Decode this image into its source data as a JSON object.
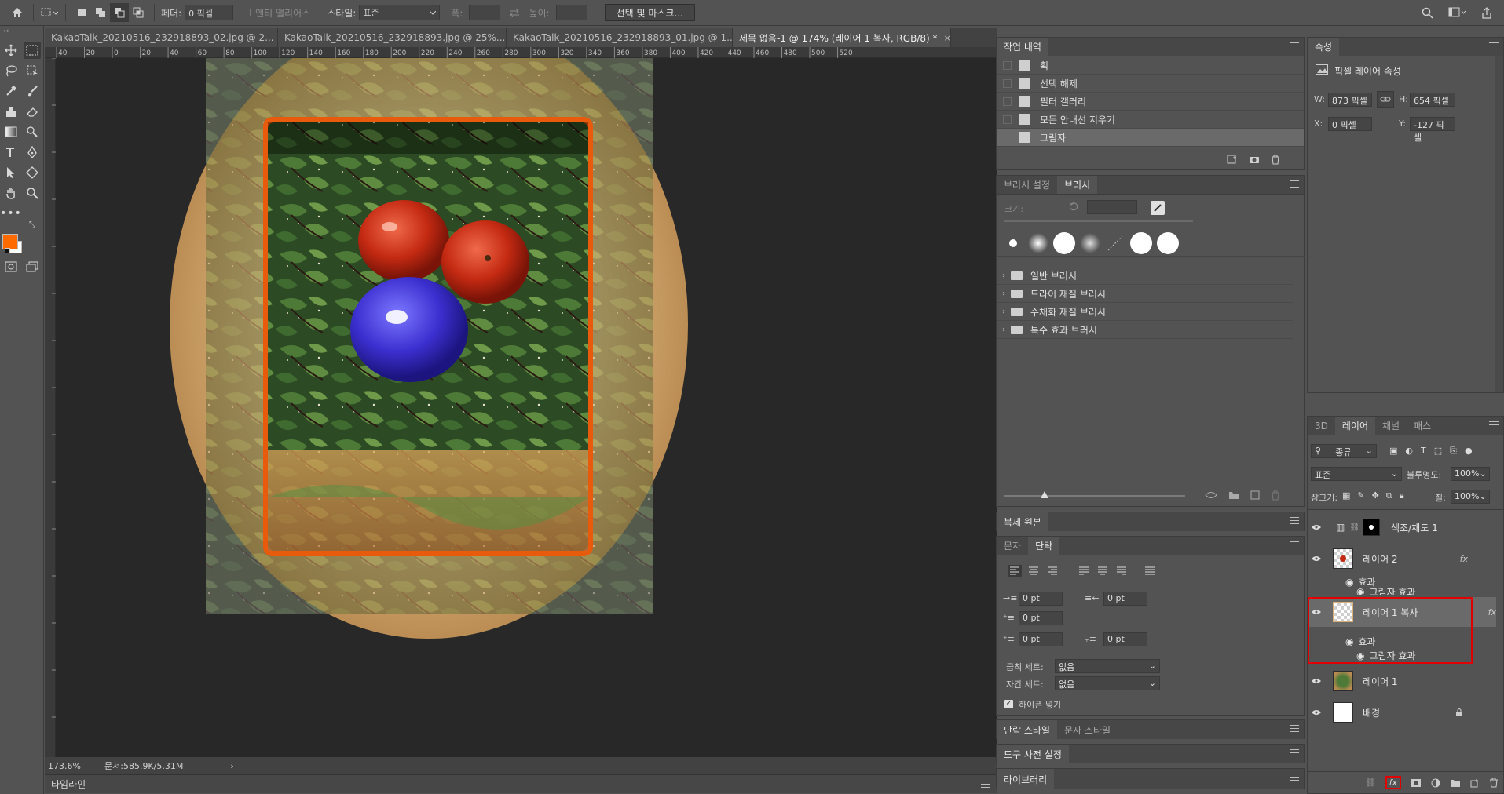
{
  "options_bar": {
    "feather_label": "페더:",
    "feather_value": "0 픽셀",
    "antialias_label": "앤티 앨리어스",
    "style_label": "스타일:",
    "style_value": "표준",
    "width_label": "폭:",
    "height_label": "높이:",
    "select_mask_button": "선택 및 마스크..."
  },
  "colors": {
    "foreground": "#ff6a00",
    "background": "#ffffff",
    "accent_highlight": "#e00000"
  },
  "tabs": [
    {
      "label": "KakaoTalk_20210516_232918893_02.jpg @ 2...",
      "close": "×"
    },
    {
      "label": "KakaoTalk_20210516_232918893.jpg @ 25%...",
      "close": "×"
    },
    {
      "label": "KakaoTalk_20210516_232918893_01.jpg @ 1...",
      "close": "×"
    },
    {
      "label": "제목 없음-1 @ 174% (레이어 1 복사, RGB/8) *",
      "close": "×"
    }
  ],
  "ruler": {
    "top_ticks": [
      "40",
      "20",
      "0",
      "20",
      "40",
      "60",
      "80",
      "100",
      "120",
      "140",
      "160",
      "180",
      "200",
      "220",
      "240",
      "260",
      "280",
      "300",
      "320",
      "340",
      "360",
      "380",
      "400",
      "420",
      "440",
      "460",
      "480",
      "500",
      "520"
    ]
  },
  "status": {
    "zoom": "173.6%",
    "doc": "문서:585.9K/5.31M",
    "arrow": "›"
  },
  "bottom_left_panel": {
    "timeline": "타임라인"
  },
  "history_panel": {
    "tab": "작업 내역",
    "items": [
      "획",
      "선택 해제",
      "필터 갤러리",
      "모든 안내선 지우기",
      "그림자"
    ]
  },
  "brush_panel": {
    "tabs": [
      "브러시 설정",
      "브러시"
    ],
    "size_label": "크기:",
    "folders": [
      "일반 브러시",
      "드라이 재질 브러시",
      "수채화 재질 브러시",
      "특수 효과 브러시"
    ]
  },
  "clone_source_panel": {
    "tab": "복제 원본"
  },
  "paragraph_panel": {
    "tabs": [
      "문자",
      "단락"
    ],
    "indent_left": "0 pt",
    "indent_right": "0 pt",
    "indent_first": "0 pt",
    "space_before": "0 pt",
    "space_after": "0 pt",
    "kinsoku_label": "금칙 세트:",
    "kinsoku_value": "없음",
    "mojikumi_label": "자간 세트:",
    "mojikumi_value": "없음",
    "hyphenate_label": "하이픈 넣기"
  },
  "styles_panel": {
    "tabs": [
      "단락 스타일",
      "문자 스타일"
    ]
  },
  "tool_presets_panel": {
    "tab": "도구 사전 설정"
  },
  "library_panel": {
    "tab": "라이브러리"
  },
  "properties_panel": {
    "tab": "속성",
    "title": "픽셀 레이어 속성",
    "w_label": "W:",
    "w_value": "873 픽셀",
    "h_label": "H:",
    "h_value": "654 픽셀",
    "x_label": "X:",
    "x_value": "0 픽셀",
    "y_label": "Y:",
    "y_value": "-127 픽셀"
  },
  "layers_panel": {
    "tabs": [
      "3D",
      "레이어",
      "채널",
      "패스"
    ],
    "filter_kind": "종류",
    "blend_mode": "표준",
    "opacity_label": "불투명도:",
    "opacity_value": "100%",
    "lock_label": "잠그기:",
    "fill_label": "칠:",
    "fill_value": "100%",
    "effects_label": "효과",
    "shadow_effect": "그림자 효과",
    "fx": "fx",
    "layers": [
      {
        "name": "색조/채도 1"
      },
      {
        "name": "레이어 2"
      },
      {
        "name": "레이어 1 복사"
      },
      {
        "name": "레이어 1"
      },
      {
        "name": "배경"
      }
    ],
    "footer_fx": "fx"
  }
}
